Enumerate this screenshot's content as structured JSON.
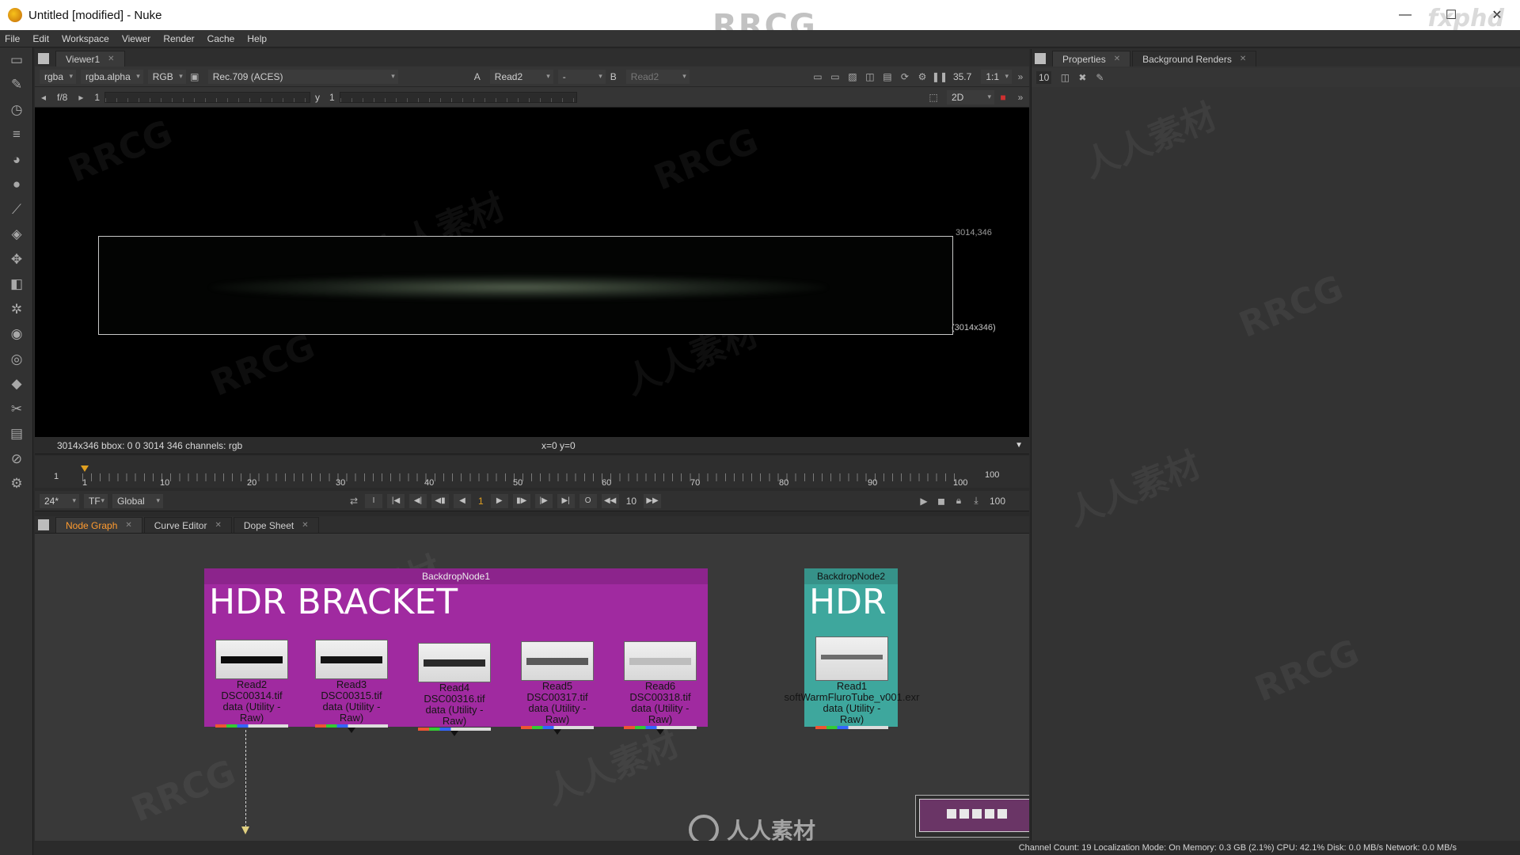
{
  "window": {
    "title": "Untitled [modified] - Nuke",
    "minimize": "—",
    "maximize": "☐",
    "close": "✕"
  },
  "menu": [
    "File",
    "Edit",
    "Workspace",
    "Viewer",
    "Render",
    "Cache",
    "Help"
  ],
  "viewer": {
    "tab": "Viewer1",
    "channels": "rgba",
    "alpha": "rgba.alpha",
    "display": "RGB",
    "colorspace": "Rec.709 (ACES)",
    "input_a_label": "A",
    "input_a": "Read2",
    "operation": "-",
    "input_b_label": "B",
    "input_b": "Read2",
    "zoom": "35.7",
    "ratio": "1:1",
    "fstop": "f/8",
    "gain": "1",
    "gamma_label": "y",
    "gamma": "1",
    "view_mode": "2D",
    "bbox_corner_top": "3014,346",
    "bbox_corner_bottom": "(3014x346)",
    "info_left": "3014x346  bbox: 0 0 3014 346 channels: rgb",
    "info_coords": "x=0 y=0"
  },
  "timeline": {
    "start": "1",
    "end": "100",
    "current_marker": "1",
    "tick_labels": [
      "1",
      "10",
      "20",
      "30",
      "40",
      "50",
      "60",
      "70",
      "80",
      "90",
      "100"
    ],
    "fps": "24*",
    "tf": "TF",
    "global": "Global",
    "current_frame": "1",
    "step": "10",
    "out_frame": "100"
  },
  "properties_panel": {
    "tabs": [
      "Properties",
      "Background Renders"
    ],
    "max_panels": "10"
  },
  "node_graph": {
    "tabs": [
      "Node Graph",
      "Curve Editor",
      "Dope Sheet"
    ],
    "backdrop1": {
      "name": "BackdropNode1",
      "title": "HDR BRACKET",
      "color": "#a02aa0"
    },
    "backdrop2": {
      "name": "BackdropNode2",
      "title": "HDR",
      "color": "#3ea79d"
    },
    "read_nodes": [
      {
        "name": "Read2",
        "file": "DSC00314.tif",
        "colorspace": "data (Utility - Raw)"
      },
      {
        "name": "Read3",
        "file": "DSC00315.tif",
        "colorspace": "data (Utility - Raw)"
      },
      {
        "name": "Read4",
        "file": "DSC00316.tif",
        "colorspace": "data (Utility - Raw)"
      },
      {
        "name": "Read5",
        "file": "DSC00317.tif",
        "colorspace": "data (Utility - Raw)"
      },
      {
        "name": "Read6",
        "file": "DSC00318.tif",
        "colorspace": "data (Utility - Raw)"
      }
    ],
    "hdr_node": {
      "name": "Read1",
      "file": "softWarmFluroTube_v001.exr",
      "colorspace": "data (Utility - Raw)"
    }
  },
  "status_bar": "Channel Count: 19  Localization Mode: On  Memory: 0.3 GB (2.1%)  CPU: 42.1%  Disk: 0.0 MB/s  Network: 0.0 MB/s",
  "watermarks": {
    "top": "RRCG",
    "corner": "fxphd",
    "bottom": "人人素材",
    "pattern": [
      "RRCG",
      "人人素材"
    ]
  }
}
